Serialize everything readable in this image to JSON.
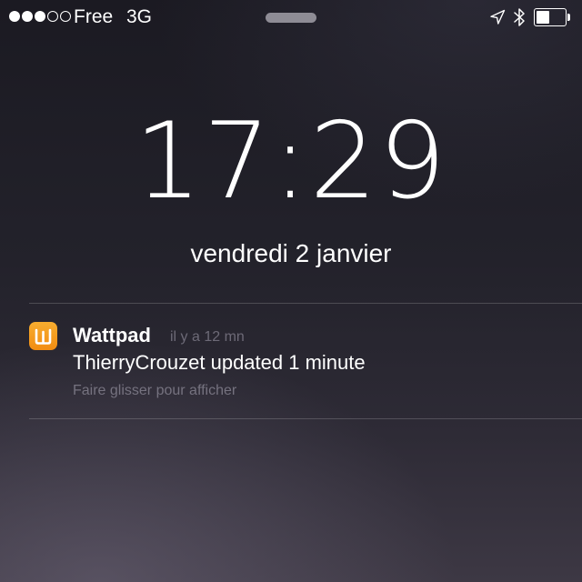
{
  "status_bar": {
    "signal_dots_filled": 3,
    "signal_dots_total": 5,
    "carrier": "Free",
    "network": "3G",
    "icons": [
      "location-icon",
      "bluetooth-icon",
      "battery-icon"
    ],
    "battery_level": 0.45
  },
  "lock_screen": {
    "time": "17:29",
    "date": "vendredi 2 janvier"
  },
  "notification": {
    "app_name": "Wattpad",
    "app_icon": "wattpad-app-icon",
    "app_icon_color": "#f39b1d",
    "time_ago": "il y a 12 mn",
    "message": "ThierryCrouzet updated 1 minute",
    "action_hint": "Faire glisser pour afficher"
  }
}
